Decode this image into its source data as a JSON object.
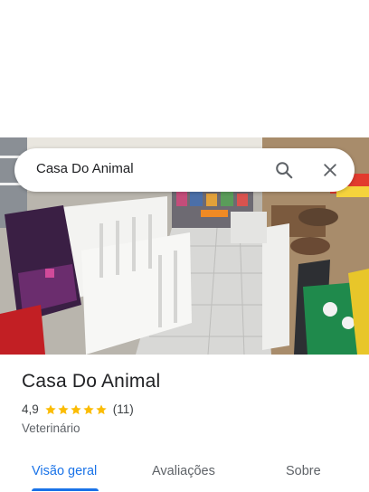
{
  "search": {
    "query": "Casa Do Animal"
  },
  "place": {
    "name": "Casa Do Animal",
    "rating": "4,9",
    "stars": 5,
    "review_count": "(11)",
    "category": "Veterinário"
  },
  "tabs": [
    {
      "label": "Visão geral",
      "active": true
    },
    {
      "label": "Avaliações",
      "active": false
    },
    {
      "label": "Sobre",
      "active": false
    }
  ],
  "colors": {
    "accent": "#1a73e8",
    "star": "#fbbc04"
  },
  "icons": {
    "search": "search-icon",
    "close": "close-icon"
  }
}
